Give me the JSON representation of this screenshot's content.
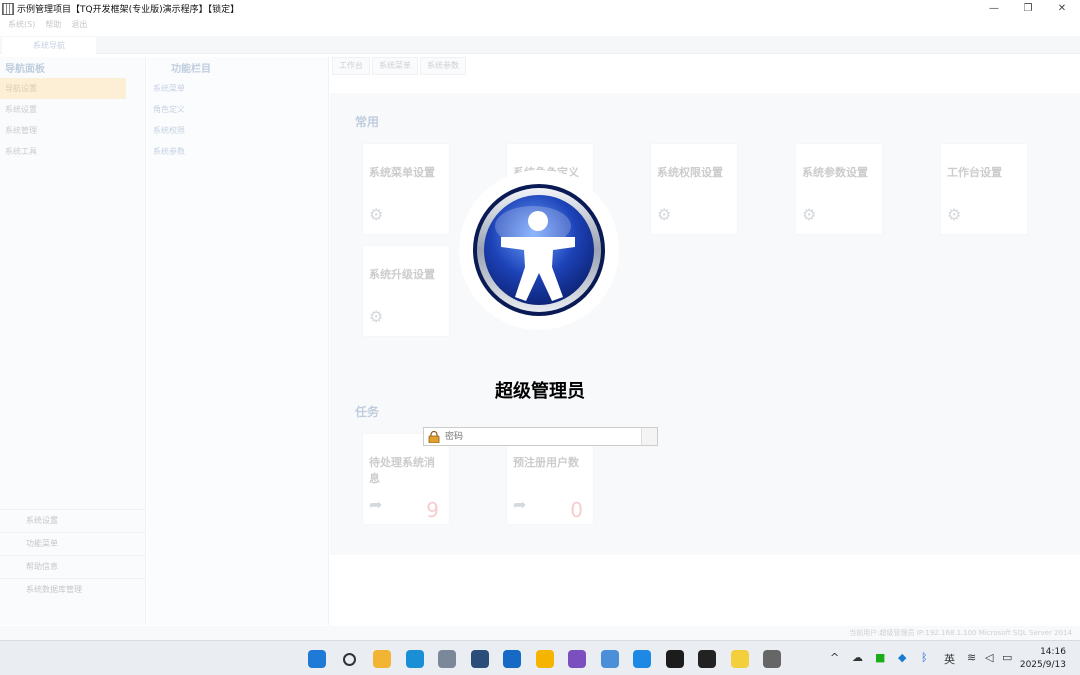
{
  "window": {
    "title": "示例管理项目【TQ开发框架(专业版)演示程序】【锁定】",
    "minimize": "—",
    "maximize": "❐",
    "close": "✕"
  },
  "background": {
    "menu": [
      "系统(S)",
      "帮助",
      "退出"
    ],
    "nav_tab": "系统导航",
    "nav_header": "导航面板",
    "nav_items": [
      "导航设置",
      "系统设置",
      "系统管理",
      "系统工具"
    ],
    "nav_bottom": [
      "系统设置",
      "功能菜单",
      "帮助信息",
      "系统数据库管理"
    ],
    "mid_header": "功能栏目",
    "mid_items": [
      "系统菜单",
      "角色定义",
      "系统权限",
      "系统参数"
    ],
    "work_tabs": [
      "工作台",
      "系统菜单",
      "系统参数"
    ],
    "section_common": "常用",
    "common_cards": [
      "系统菜单设置",
      "系统角色定义",
      "系统权限设置",
      "系统参数设置",
      "工作台设置",
      "系统升级设置"
    ],
    "section_tasks": "任务",
    "task_cards": [
      {
        "title": "待处理系统消息",
        "count": "9"
      },
      {
        "title": "预注册用户数",
        "count": "0"
      }
    ],
    "status_left": "",
    "status_right": "当前用户:超级管理员  IP:192.168.1.100  Microsoft SQL Server 2014"
  },
  "lock": {
    "user_name": "超级管理员",
    "password_placeholder": "密码"
  },
  "taskbar": {
    "input_method": "英",
    "time": "14:16",
    "date": "2025/9/13",
    "apps": [
      {
        "name": "start-icon",
        "color": "#1e7ad6"
      },
      {
        "name": "search-icon",
        "color": "#333333"
      },
      {
        "name": "file-explorer-icon",
        "color": "#f2b533"
      },
      {
        "name": "edge-icon",
        "color": "#1b8fd6"
      },
      {
        "name": "tools-icon",
        "color": "#7a8899"
      },
      {
        "name": "sql-icon",
        "color": "#2b4d7a"
      },
      {
        "name": "outlook-icon",
        "color": "#1669c4"
      },
      {
        "name": "pen-icon",
        "color": "#f4b400"
      },
      {
        "name": "visual-studio-icon",
        "color": "#7b4fbd"
      },
      {
        "name": "settings-app-icon",
        "color": "#4a8fd8"
      },
      {
        "name": "vscode-icon",
        "color": "#1e88e5"
      },
      {
        "name": "terminal-icon",
        "color": "#1c1c1c"
      },
      {
        "name": "dark-app-icon",
        "color": "#222222"
      },
      {
        "name": "notes-icon",
        "color": "#f3cf3c"
      },
      {
        "name": "grid-app-icon",
        "color": "#666666"
      }
    ]
  }
}
